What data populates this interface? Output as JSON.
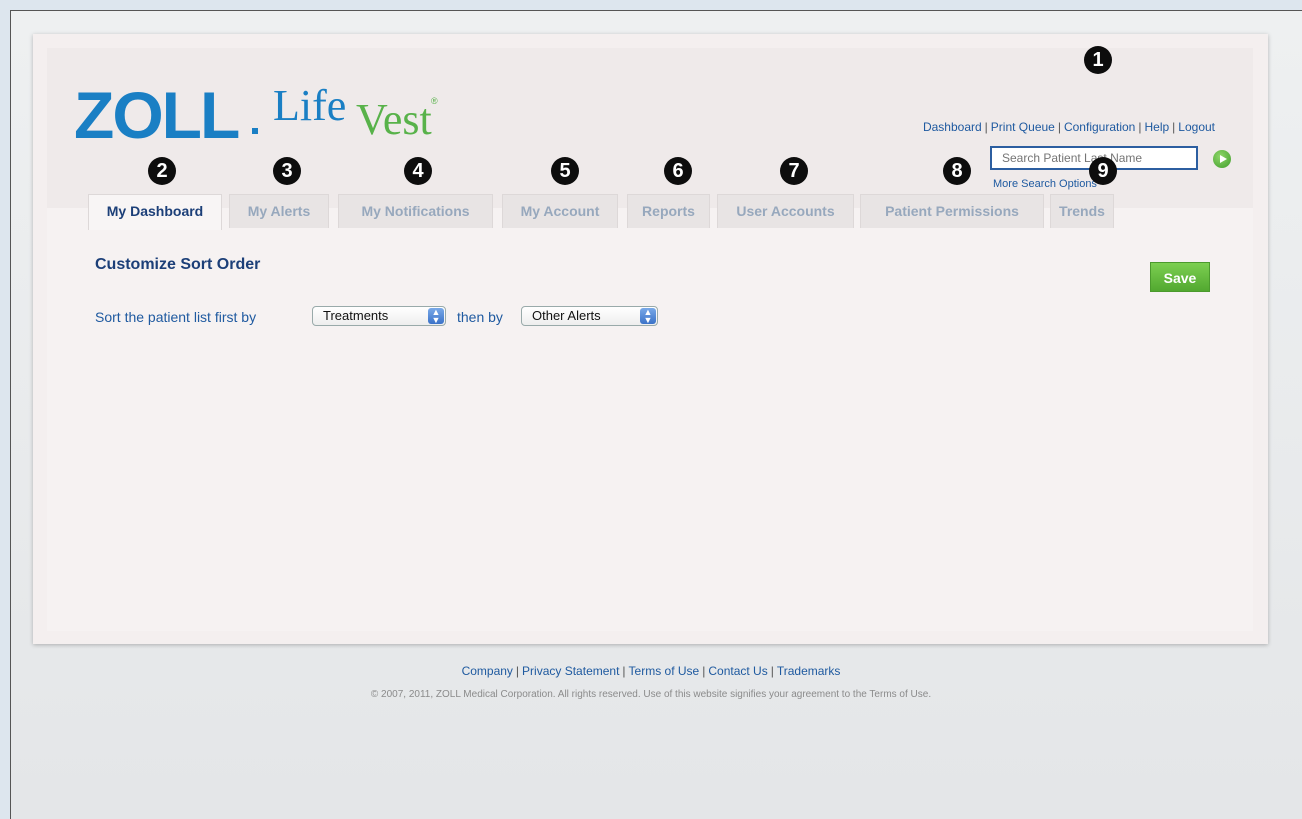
{
  "logo": {
    "brand": "ZOLL",
    "product_part1": "Life",
    "product_part2": "Vest",
    "reg": "®"
  },
  "top_nav": {
    "items": [
      "Dashboard",
      "Print Queue",
      "Configuration",
      "Help",
      "Logout"
    ],
    "separator": "|"
  },
  "search": {
    "placeholder": "Search Patient Last Name",
    "more_options": "More Search Options"
  },
  "tabs": [
    {
      "label": "My Dashboard",
      "active": true
    },
    {
      "label": "My Alerts",
      "active": false
    },
    {
      "label": "My Notifications",
      "active": false
    },
    {
      "label": "My Account",
      "active": false
    },
    {
      "label": "Reports",
      "active": false
    },
    {
      "label": "User Accounts",
      "active": false
    },
    {
      "label": "Patient Permissions",
      "active": false
    },
    {
      "label": "Trends",
      "active": false
    }
  ],
  "callouts": [
    "1",
    "2",
    "3",
    "4",
    "5",
    "6",
    "7",
    "8",
    "9"
  ],
  "content": {
    "title": "Customize Sort Order",
    "save_label": "Save",
    "sort_prefix": "Sort the patient list first by",
    "first_sort_value": "Treatments",
    "then_by": "then by",
    "second_sort_value": "Other Alerts"
  },
  "footer": {
    "links": [
      "Company",
      "Privacy Statement",
      "Terms of Use",
      "Contact Us",
      "Trademarks"
    ],
    "copyright": "© 2007, 2011, ZOLL Medical Corporation. All rights reserved. Use of this website signifies your agreement to the Terms of Use."
  },
  "colors": {
    "brand_blue": "#1a7fc4",
    "brand_green": "#58b24a",
    "link_blue": "#1f5aa0",
    "title_navy": "#1c3f78",
    "save_green": "#6abf42"
  }
}
